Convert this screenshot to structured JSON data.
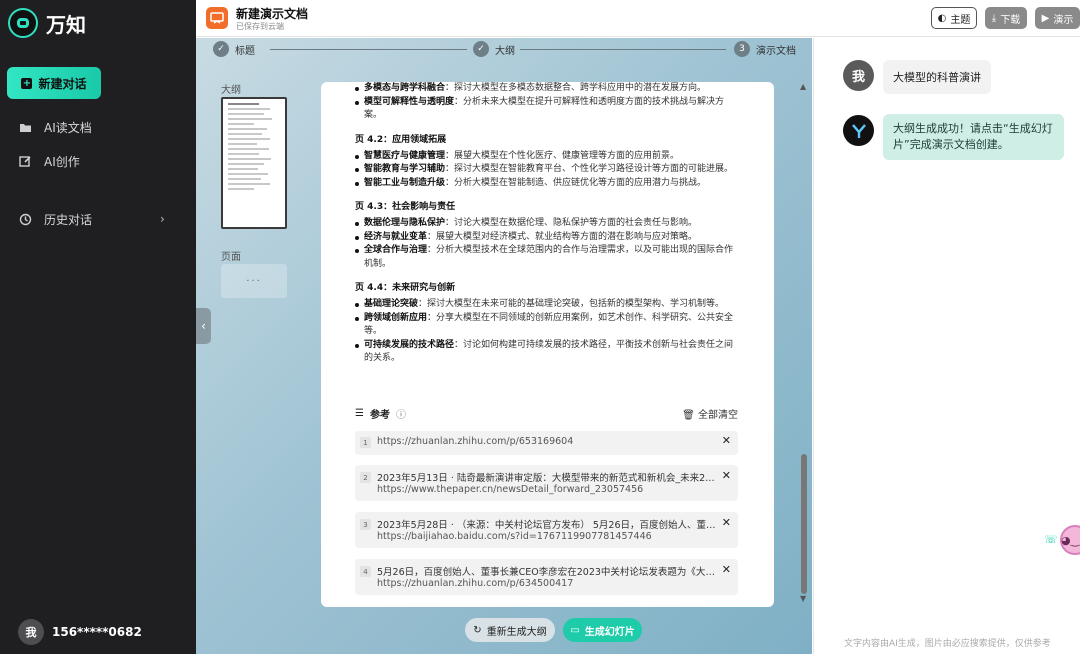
{
  "sidebar": {
    "brand": "万知",
    "new_chat": "新建对话",
    "items": [
      {
        "label": "AI读文档",
        "icon": "folder-icon"
      },
      {
        "label": "AI创作",
        "icon": "edit-icon"
      },
      {
        "label": "历史对话",
        "icon": "history-icon"
      }
    ],
    "user": {
      "avatar": "我",
      "phone": "156*****0682"
    }
  },
  "topbar": {
    "title": "新建演示文档",
    "subtitle": "已保存到云端",
    "theme": "主题",
    "download": "下载",
    "present": "演示"
  },
  "steps": [
    {
      "label": "标题",
      "state": "done"
    },
    {
      "label": "大纲",
      "state": "done"
    },
    {
      "label": "演示文档",
      "number": "3",
      "state": "current"
    }
  ],
  "left_panel": {
    "outline_label": "大纲",
    "page_label": "页面",
    "dots": "···"
  },
  "outline": {
    "top_bullets": [
      {
        "bold": "多模态与跨学科融合",
        "text": "：探讨大模型在多模态数据整合、跨学科应用中的潜在发展方向。"
      },
      {
        "bold": "模型可解释性与透明度",
        "text": "：分析未来大模型在提升可解释性和透明度方面的技术挑战与解决方案。"
      }
    ],
    "sections": [
      {
        "title": "页 4.2：应用领域拓展",
        "bullets": [
          {
            "bold": "智慧医疗与健康管理",
            "text": "：展望大模型在个性化医疗、健康管理等方面的应用前景。"
          },
          {
            "bold": "智能教育与学习辅助",
            "text": "：探讨大模型在智能教育平台、个性化学习路径设计等方面的可能进展。"
          },
          {
            "bold": "智能工业与制造升级",
            "text": "：分析大模型在智能制造、供应链优化等方面的应用潜力与挑战。"
          }
        ]
      },
      {
        "title": "页 4.3：社会影响与责任",
        "bullets": [
          {
            "bold": "数据伦理与隐私保护",
            "text": "：讨论大模型在数据伦理、隐私保护等方面的社会责任与影响。"
          },
          {
            "bold": "经济与就业变革",
            "text": "：展望大模型对经济模式、就业结构等方面的潜在影响与应对策略。"
          },
          {
            "bold": "全球合作与治理",
            "text": "：分析大模型技术在全球范围内的合作与治理需求，以及可能出现的国际合作机制。"
          }
        ]
      },
      {
        "title": "页 4.4：未来研究与创新",
        "bullets": [
          {
            "bold": "基础理论突破",
            "text": "：探讨大模型在未来可能的基础理论突破，包括新的模型架构、学习机制等。"
          },
          {
            "bold": "跨领域创新应用",
            "text": "：分享大模型在不同领域的创新应用案例，如艺术创作、科学研究、公共安全等。"
          },
          {
            "bold": "可持续发展的技术路径",
            "text": "：讨论如何构建可持续发展的技术路径，平衡技术创新与社会责任之间的关系。"
          }
        ]
      }
    ]
  },
  "references": {
    "label": "参考",
    "clear": "全部清空",
    "items": [
      {
        "num": "1",
        "title": "",
        "url": "https://zhuanlan.zhihu.com/p/653169604"
      },
      {
        "num": "2",
        "title": "2023年5月13日 · 陆奇最新演讲审定版：大模型带来的新范式和新机会_未来2%_...",
        "url": "https://www.thepaper.cn/newsDetail_forward_23057456"
      },
      {
        "num": "3",
        "title": "2023年5月28日 · （来源：中关村论坛官方发布） 5月26日，百度创始人、董事...",
        "url": "https://baijiahao.baidu.com/s?id=1767119907781457446"
      },
      {
        "num": "4",
        "title": "5月26日，百度创始人、董事长兼CEO李彦宏在2023中关村论坛发表题为《大模...",
        "url": "https://zhuanlan.zhihu.com/p/634500417"
      }
    ]
  },
  "actions": {
    "regenerate": "重新生成大纲",
    "generate": "生成幻灯片"
  },
  "chat": {
    "user_avatar": "我",
    "user_message": "大模型的科普演讲",
    "bot_message": "大纲生成成功！请点击“生成幻灯片”完成演示文档创建。",
    "disclaimer": "文字内容由AI生成，图片由必应搜索提供，仅供参考"
  },
  "colors": {
    "accent": "#1ecca9",
    "sidebar_bg": "#1f1f22",
    "doc_icon": "#f26c2a"
  }
}
